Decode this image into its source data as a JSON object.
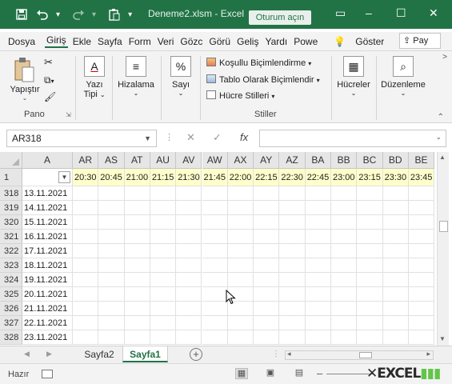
{
  "titlebar": {
    "title": "Deneme2.xlsm - Excel",
    "login_button": "Oturum açın",
    "save_icon": "save-icon",
    "undo_icon": "undo-icon",
    "redo_icon": "redo-icon",
    "paste_icon": "clipboard-icon",
    "minimize": "–",
    "restore": "☐",
    "close": "✕",
    "ribbon_display": "▭"
  },
  "tabs": [
    "Dosya",
    "Giriş",
    "Ekle",
    "Sayfa",
    "Form",
    "Veri",
    "Gözc",
    "Görü",
    "Geliş",
    "Yardı",
    "Powe"
  ],
  "tell_me": "Göster",
  "share": "Pay",
  "ribbon": {
    "paste": "Yapıştır",
    "clipboard_group": "Pano",
    "font": "Yazı\nTipi",
    "font_l1": "Yazı",
    "font_l2": "Tipi",
    "alignment": "Hizalama",
    "number": "Sayı",
    "conditional": "Koşullu Biçimlendirme",
    "format_table": "Tablo Olarak Biçimlendir",
    "cell_styles": "Hücre Stilleri",
    "styles_group": "Stiller",
    "cells": "Hücreler",
    "editing": "Düzenleme"
  },
  "formula_bar": {
    "name_box": "AR318",
    "cancel": "✕",
    "enter": "✓",
    "fx": "fx",
    "value": ""
  },
  "grid": {
    "column_a": "A",
    "columns": [
      "AR",
      "AS",
      "AT",
      "AU",
      "AV",
      "AW",
      "AX",
      "AY",
      "AZ",
      "BA",
      "BB",
      "BC",
      "BD",
      "BE"
    ],
    "header_row_label": "1",
    "header_times": [
      "20:30",
      "20:45",
      "21:00",
      "21:15",
      "21:30",
      "21:45",
      "22:00",
      "22:15",
      "22:30",
      "22:45",
      "23:00",
      "23:15",
      "23:30",
      "23:45"
    ],
    "rows": [
      {
        "num": "318",
        "date": "13.11.2021"
      },
      {
        "num": "319",
        "date": "14.11.2021"
      },
      {
        "num": "320",
        "date": "15.11.2021"
      },
      {
        "num": "321",
        "date": "16.11.2021"
      },
      {
        "num": "322",
        "date": "17.11.2021"
      },
      {
        "num": "323",
        "date": "18.11.2021"
      },
      {
        "num": "324",
        "date": "19.11.2021"
      },
      {
        "num": "325",
        "date": "20.11.2021"
      },
      {
        "num": "326",
        "date": "21.11.2021"
      },
      {
        "num": "327",
        "date": "22.11.2021"
      },
      {
        "num": "328",
        "date": "23.11.2021"
      }
    ]
  },
  "sheets": {
    "tabs": [
      "Sayfa2",
      "Sayfa1"
    ],
    "active": "Sayfa1",
    "add": "+"
  },
  "status": {
    "ready": "Hazır",
    "logo_text": "EXCEL"
  },
  "colors": {
    "brand": "#217346",
    "time_fill": "#ffffcc",
    "header_fill": "#e6e6e6"
  }
}
